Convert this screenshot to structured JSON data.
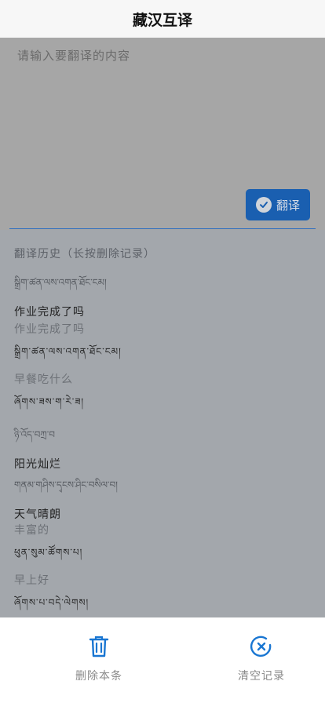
{
  "header": {
    "title": "藏汉互译"
  },
  "input": {
    "placeholder": "请输入要翻译的内容",
    "value": ""
  },
  "translate_button": {
    "label": "翻译"
  },
  "history": {
    "heading": "翻译历史（长按删除记录）",
    "items": [
      {
        "source": "སྒྲིག་ཚན་ལས་འགན་ཐོང་ངམ།",
        "target": "作业完成了吗",
        "source_lang": "bo"
      },
      {
        "source": "作业完成了吗",
        "target": "སྒྲིག་ཚན་ལས་འགན་ཐོང་ངམ།",
        "source_lang": "zh"
      },
      {
        "source": "早餐吃什么",
        "target": "ཞོགས་ཟས་ག་རེ་ཟ།",
        "source_lang": "zh"
      },
      {
        "source": "ཉི་འོད་བཀྲ་བ",
        "target": "阳光灿烂",
        "source_lang": "bo"
      },
      {
        "source": "གནམ་གཤིས་དྭངས་ཤིང་བསིལ་བ།",
        "target": "天气晴朗",
        "source_lang": "bo"
      },
      {
        "source": "丰富的",
        "target": "ཕུན་སུམ་ཚོགས་པ།",
        "source_lang": "zh"
      },
      {
        "source": "早上好",
        "target": "ཞོགས་པ་བདེ་ལེགས།",
        "source_lang": "zh"
      }
    ]
  },
  "footer": {
    "delete_label": "删除本条",
    "clear_label": "清空记录"
  },
  "colors": {
    "accent": "#1a5fb0",
    "icon_blue": "#1976d2"
  }
}
